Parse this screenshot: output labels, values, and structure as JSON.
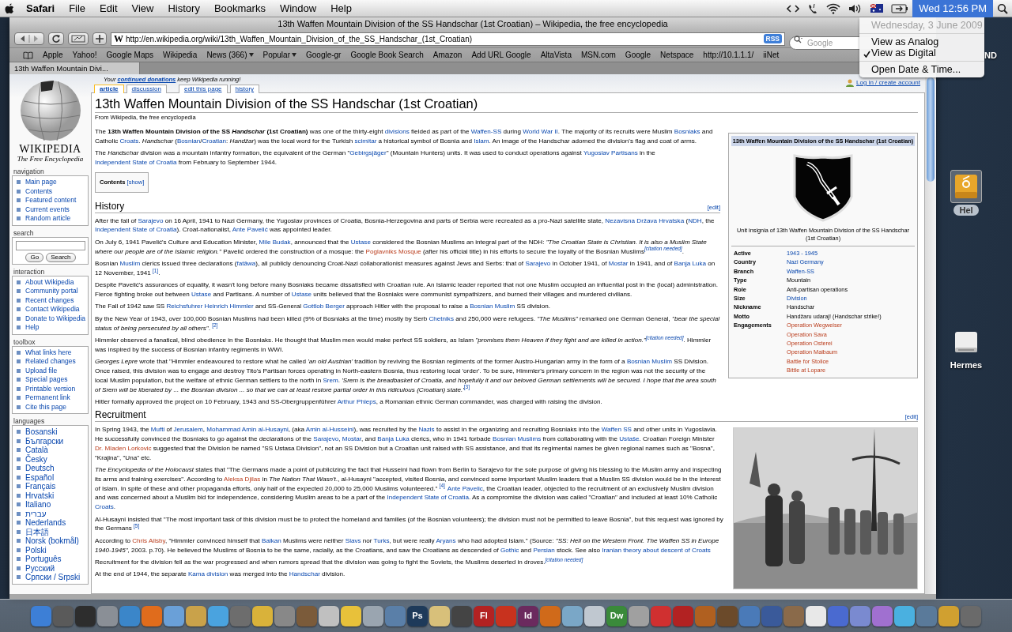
{
  "menubar": {
    "app_menu": "Safari",
    "menus": [
      "File",
      "Edit",
      "View",
      "History",
      "Bookmarks",
      "Window",
      "Help"
    ],
    "clock": {
      "label": "Wed 12:56 PM",
      "open": true
    }
  },
  "clock_menu": [
    {
      "label": "Wednesday, 3 June 2009",
      "kind": "date",
      "disabled": true,
      "checked": false
    },
    {
      "label": "View as Analog",
      "kind": "option",
      "disabled": false,
      "checked": false
    },
    {
      "label": "View as Digital",
      "kind": "option",
      "disabled": false,
      "checked": true
    },
    {
      "label": "Open Date & Time...",
      "kind": "action",
      "disabled": false,
      "checked": false
    }
  ],
  "window": {
    "title": "13th Waffen Mountain Division of the SS Handschar (1st Croatian) – Wikipedia, the free encyclopedia",
    "url": "http://en.wikipedia.org/wiki/13th_Waffen_Mountain_Division_of_the_SS_Handschar_(1st_Croatian)",
    "favicon": "W",
    "feed_badge": "RSS",
    "search_placeholder": "Google",
    "bookmarks": [
      {
        "label": "Apple",
        "kind": "link"
      },
      {
        "label": "Yahoo!",
        "kind": "link"
      },
      {
        "label": "Google Maps",
        "kind": "link"
      },
      {
        "label": "Wikipedia",
        "kind": "link"
      },
      {
        "label": "News (366)",
        "kind": "folder"
      },
      {
        "label": "Popular",
        "kind": "folder"
      },
      {
        "label": "Google-gr",
        "kind": "link"
      },
      {
        "label": "Google Book Search",
        "kind": "link"
      },
      {
        "label": "Amazon",
        "kind": "link"
      },
      {
        "label": "Add URL Google",
        "kind": "link"
      },
      {
        "label": "AltaVista",
        "kind": "link"
      },
      {
        "label": "MSN.com",
        "kind": "link"
      },
      {
        "label": "Google",
        "kind": "link"
      },
      {
        "label": "Netspace",
        "kind": "link"
      },
      {
        "label": "http://10.1.1.1/",
        "kind": "link"
      },
      {
        "label": "iiNet",
        "kind": "link"
      }
    ],
    "tabs": [
      {
        "label": "13th Waffen Mountain Divi...",
        "selected": true
      }
    ]
  },
  "page": {
    "notice": [
      {
        "kind": "text",
        "text": "Your "
      },
      {
        "kind": "link",
        "text": "continued donations"
      },
      {
        "kind": "text",
        "text": " keep Wikipedia running!"
      }
    ],
    "tabs": [
      {
        "label": "article",
        "selected": true
      },
      {
        "label": "discussion",
        "selected": false
      },
      {
        "label": "edit this page",
        "selected": false
      },
      {
        "label": "history",
        "selected": false
      }
    ],
    "login": "Log in / create account",
    "sidebar": {
      "logo_title": "WIKIPEDIA",
      "logo_tagline": "The Free Encyclopedia",
      "portlets": [
        {
          "title": "navigation",
          "kind": "links",
          "items": [
            "Main page",
            "Contents",
            "Featured content",
            "Current events",
            "Random article"
          ]
        },
        {
          "title": "search",
          "kind": "search",
          "buttons": [
            "Go",
            "Search"
          ]
        },
        {
          "title": "interaction",
          "kind": "links",
          "items": [
            "About Wikipedia",
            "Community portal",
            "Recent changes",
            "Contact Wikipedia",
            "Donate to Wikipedia",
            "Help"
          ]
        },
        {
          "title": "toolbox",
          "kind": "links",
          "items": [
            "What links here",
            "Related changes",
            "Upload file",
            "Special pages",
            "Printable version",
            "Permanent link",
            "Cite this page"
          ]
        },
        {
          "title": "languages",
          "kind": "languages",
          "items": [
            "Bosanski",
            "Български",
            "Català",
            "Česky",
            "Deutsch",
            "Español",
            "Français",
            "Hrvatski",
            "Italiano",
            "עברית",
            "Nederlands",
            "日本語",
            "Norsk (bokmål)",
            "Polski",
            "Português",
            "Русский",
            "Српски / Srpski"
          ]
        }
      ]
    },
    "article": {
      "title": "13th Waffen Mountain Division of the SS Handschar (1st Croatian)",
      "subtitle": "From Wikipedia, the free encyclopedia",
      "infobox": {
        "title": "13th Waffen Mountain Division of the SS Handschar (1st Croatian)",
        "caption": "Unit insignia of 13th Waffen Mountain Division of the SS Handschar (1st Croatian)",
        "rows": [
          {
            "label": "Active",
            "values": [
              {
                "kind": "link",
                "text": "1943 - 1945"
              }
            ]
          },
          {
            "label": "Country",
            "values": [
              {
                "kind": "link",
                "text": "Nazi Germany"
              }
            ]
          },
          {
            "label": "Branch",
            "values": [
              {
                "kind": "link",
                "text": "Waffen-SS"
              }
            ]
          },
          {
            "label": "Type",
            "values": [
              {
                "kind": "text",
                "text": "Mountain"
              }
            ]
          },
          {
            "label": "Role",
            "values": [
              {
                "kind": "text",
                "text": "Anti-partisan operations"
              }
            ]
          },
          {
            "label": "Size",
            "values": [
              {
                "kind": "link",
                "text": "Division"
              }
            ]
          },
          {
            "label": "Nickname",
            "values": [
              {
                "kind": "text",
                "text": "Handschar"
              }
            ]
          },
          {
            "label": "Motto",
            "values": [
              {
                "kind": "text",
                "text": "Handžaru udaraj! (Handschar strike!)"
              }
            ]
          },
          {
            "label": "Engagements",
            "values": [
              {
                "kind": "redlink",
                "text": "Operation Wegweiser"
              },
              {
                "kind": "redlink",
                "text": "Operation Sava"
              },
              {
                "kind": "redlink",
                "text": "Operation Osterei"
              },
              {
                "kind": "redlink",
                "text": "Operation Maibaum"
              },
              {
                "kind": "redlink",
                "text": "Battle for Stolice"
              },
              {
                "kind": "redlink",
                "text": "Bittle at Lopare"
              }
            ]
          }
        ]
      },
      "intro": [
        [
          {
            "kind": "text",
            "text": "The "
          },
          {
            "kind": "bold",
            "text": "13th Waffen Mountain Division of the SS "
          },
          {
            "kind": "bolditalic",
            "text": "Handschar"
          },
          {
            "kind": "bold",
            "text": " (1st Croatian)"
          },
          {
            "kind": "text",
            "text": " was one of the thirty-eight "
          },
          {
            "kind": "link",
            "text": "divisions"
          },
          {
            "kind": "text",
            "text": " fielded as part of the "
          },
          {
            "kind": "link",
            "text": "Waffen-SS"
          },
          {
            "kind": "text",
            "text": " during "
          },
          {
            "kind": "link",
            "text": "World War II"
          },
          {
            "kind": "text",
            "text": ". The majority of its recruits were Muslim "
          },
          {
            "kind": "link",
            "text": "Bosniaks"
          },
          {
            "kind": "text",
            "text": " and Catholic "
          },
          {
            "kind": "link",
            "text": "Croats"
          },
          {
            "kind": "text",
            "text": ". *Handschar* ("
          },
          {
            "kind": "link",
            "text": "Bosnian"
          },
          {
            "kind": "text",
            "text": "/"
          },
          {
            "kind": "link",
            "text": "Croatian"
          },
          {
            "kind": "text",
            "text": ": *Handžar*) was the local word for the Turkish "
          },
          {
            "kind": "link",
            "text": "scimitar"
          },
          {
            "kind": "text",
            "text": " a historical symbol of Bosnia and "
          },
          {
            "kind": "link",
            "text": "Islam"
          },
          {
            "kind": "text",
            "text": ". An image of the Handschar adorned the division's flag and coat of arms."
          }
        ],
        [
          {
            "kind": "text",
            "text": "The *Handschar* division was a mountain infantry formation, the equivalent of the German \""
          },
          {
            "kind": "link",
            "text": "Gebirgsjäger"
          },
          {
            "kind": "text",
            "text": "\" (Mountain Hunters) units. It was used to conduct operations against "
          },
          {
            "kind": "link",
            "text": "Yugoslav Partisans"
          },
          {
            "kind": "text",
            "text": " in the "
          },
          {
            "kind": "link",
            "text": "Independent State of Croatia"
          },
          {
            "kind": "text",
            "text": " from February to September 1944."
          }
        ]
      ],
      "contents": {
        "label": "Contents",
        "toggle": "[show]"
      },
      "sections": [
        {
          "heading": "History",
          "edit": "[edit]",
          "paragraphs": [
            [
              {
                "kind": "text",
                "text": "After the fall of "
              },
              {
                "kind": "link",
                "text": "Sarajevo"
              },
              {
                "kind": "text",
                "text": " on 16 April, 1941 to Nazi Germany, the Yugoslav provinces of Croatia, Bosnia-Herzegovina and parts of Serbia were recreated as a pro-Nazi satellite state, "
              },
              {
                "kind": "link",
                "text": "Nezavisna Država Hrvatska"
              },
              {
                "kind": "text",
                "text": " ("
              },
              {
                "kind": "link",
                "text": "NDH"
              },
              {
                "kind": "text",
                "text": ", the "
              },
              {
                "kind": "link",
                "text": "Independent State of Croatia"
              },
              {
                "kind": "text",
                "text": "). Croat-nationalist, "
              },
              {
                "kind": "link",
                "text": "Ante Pavelić"
              },
              {
                "kind": "text",
                "text": " was appointed leader."
              }
            ],
            [
              {
                "kind": "text",
                "text": "On July 6, 1941 Pavelić's Culture and Education Minister, "
              },
              {
                "kind": "link",
                "text": "Mile Budak"
              },
              {
                "kind": "text",
                "text": ", announced that the "
              },
              {
                "kind": "link",
                "text": "Ustase"
              },
              {
                "kind": "text",
                "text": " considered the Bosnian Muslims an integral part of the NDH: *\"The Croatian State is Christian. It is also a Muslim State where our people are of the Islamic religion.\"* Pavelić ordered the construction of a mosque: the "
              },
              {
                "kind": "redlink",
                "text": "Poglavniks Mosque"
              },
              {
                "kind": "text",
                "text": " (after his official title) in his efforts to secure the loyalty of the Bosnian Muslims"
              },
              {
                "kind": "cite",
                "text": "[citation needed]"
              },
              {
                "kind": "text",
                "text": "."
              }
            ],
            [
              {
                "kind": "text",
                "text": "Bosnian "
              },
              {
                "kind": "link",
                "text": "Muslim"
              },
              {
                "kind": "text",
                "text": " clerics issued three declarations ("
              },
              {
                "kind": "link",
                "text": "fatāwa"
              },
              {
                "kind": "text",
                "text": "), all publicly denouncing Croat-Nazi collaborationist measures against Jews and Serbs: that of "
              },
              {
                "kind": "link",
                "text": "Sarajevo"
              },
              {
                "kind": "text",
                "text": " in October 1941, of "
              },
              {
                "kind": "link",
                "text": "Mostar"
              },
              {
                "kind": "text",
                "text": " in 1941, and of "
              },
              {
                "kind": "link",
                "text": "Banja Luka"
              },
              {
                "kind": "text",
                "text": " on 12 November, 1941 "
              },
              {
                "kind": "ref",
                "text": "[1]"
              },
              {
                "kind": "text",
                "text": "."
              }
            ],
            [
              {
                "kind": "text",
                "text": "Despite Pavelić's assurances of equality, it wasn't long before many Bosniaks became dissatisfied with Croatian rule. An Islamic leader reported that not one Muslim occupied an influential post in the (local) administration. Fierce fighting broke out between "
              },
              {
                "kind": "link",
                "text": "Ustase"
              },
              {
                "kind": "text",
                "text": " and Partisans. A number of "
              },
              {
                "kind": "link",
                "text": "Ustase"
              },
              {
                "kind": "text",
                "text": " units believed that the Bosniaks were communist sympathizers, and burned their villages and murdered civilians."
              }
            ],
            [
              {
                "kind": "text",
                "text": "The Fall of 1942 saw SS "
              },
              {
                "kind": "link",
                "text": "Reichsfuhrer Heinrich Himmler"
              },
              {
                "kind": "text",
                "text": " and SS-General "
              },
              {
                "kind": "link",
                "text": "Gottlob Berger"
              },
              {
                "kind": "text",
                "text": " approach Hitler with the proposal to raise a "
              },
              {
                "kind": "link",
                "text": "Bosnian Muslim"
              },
              {
                "kind": "text",
                "text": " SS division."
              }
            ],
            [
              {
                "kind": "text",
                "text": "By the New Year of 1943, over 100,000 Bosnian Muslims had been killed (9% of Bosniaks at the time) mostly by Serb "
              },
              {
                "kind": "link",
                "text": "Chetniks"
              },
              {
                "kind": "text",
                "text": " and 250,000 were refugees. *\"The Muslims\"* remarked one German General, *\"bear the special status of being persecuted by all others\"*. "
              },
              {
                "kind": "ref",
                "text": "[2]"
              }
            ],
            [
              {
                "kind": "text",
                "text": "Himmler observed a fanatical, blind obedience in the Bosniaks. He thought that Muslim men would make perfect SS soldiers, as Islam *\"promises them Heaven if they fight and are killed in action.\"*"
              },
              {
                "kind": "cite",
                "text": "[citation needed]"
              },
              {
                "kind": "text",
                "text": ". Himmler was inspired by the success of Bosnian infantry regiments in WWI."
              }
            ],
            [
              {
                "kind": "text",
                "text": "*Georges Lepre* wrote that \"Himmler endeavoured to restore what he called *'an old Austrian'* tradition by reviving the Bosnian regiments of the former Austro-Hungarian army in the form of a "
              },
              {
                "kind": "link",
                "text": "Bosnian Muslim"
              },
              {
                "kind": "text",
                "text": " SS Division. Once raised, this division was to engage and destroy Tito's Partisan forces operating in North-eastern Bosnia, thus restoring local 'order'. To be sure, Himmler's primary concern in the region was not the security of the local Muslim population, but the welfare of ethnic German settlers to the north in "
              },
              {
                "kind": "link",
                "text": "Srem"
              },
              {
                "kind": "text",
                "text": ". *'Srem is the breadbasket of Croatia, and hopefully it and our beloved German settlements will be secured. I hope that the area south of Srem will be liberated by ... the Bosnian division ... so that we can at least restore partial order in this ridiculous (Croatian) state.'*"
              },
              {
                "kind": "ref",
                "text": "[3]"
              }
            ],
            [
              {
                "kind": "text",
                "text": "Hitler formally approved the project on 10 February, 1943 and SS-Obergruppenführer "
              },
              {
                "kind": "link",
                "text": "Arthur Phleps"
              },
              {
                "kind": "text",
                "text": ", a Romanian ethnic German commander, was charged with raising the division."
              }
            ]
          ]
        },
        {
          "heading": "Recruitment",
          "edit": "[edit]",
          "figure": {
            "kind": "picture"
          },
          "paragraphs": [
            [
              {
                "kind": "text",
                "text": "In Spring 1943, the "
              },
              {
                "kind": "link",
                "text": "Mufti"
              },
              {
                "kind": "text",
                "text": " of "
              },
              {
                "kind": "link",
                "text": "Jerusalem"
              },
              {
                "kind": "text",
                "text": ", "
              },
              {
                "kind": "link",
                "text": "Mohammad Amin al-Husayni"
              },
              {
                "kind": "text",
                "text": ", (aka "
              },
              {
                "kind": "link",
                "text": "Amin al-Husseini"
              },
              {
                "kind": "text",
                "text": "), was recruited by the "
              },
              {
                "kind": "link",
                "text": "Nazis"
              },
              {
                "kind": "text",
                "text": " to assist in the organizing and recruiting Bosniaks into the "
              },
              {
                "kind": "link",
                "text": "Waffen SS"
              },
              {
                "kind": "text",
                "text": " and other units in Yugoslavia. He successfully convinced the Bosniaks to go against the declarations of the "
              },
              {
                "kind": "link",
                "text": "Sarajevo"
              },
              {
                "kind": "text",
                "text": ", "
              },
              {
                "kind": "link",
                "text": "Mostar"
              },
              {
                "kind": "text",
                "text": ", and "
              },
              {
                "kind": "link",
                "text": "Banja Luka"
              },
              {
                "kind": "text",
                "text": " clerics, who in 1941 forbade "
              },
              {
                "kind": "link",
                "text": "Bosnian Muslims"
              },
              {
                "kind": "text",
                "text": " from collaborating with the "
              },
              {
                "kind": "link",
                "text": "Ustaše"
              },
              {
                "kind": "text",
                "text": ". Croatian Foreign Minister "
              },
              {
                "kind": "redlink",
                "text": "Dr. Mladen Lorkovic"
              },
              {
                "kind": "text",
                "text": " suggested that the Division be named \"SS Ustasa Division\", not an SS Division but a Croatian unit raised with SS assistance, and that its regimental names be given regional names such as \"Bosna\", \"Krajina\", \"Una\" etc."
              }
            ],
            [
              {
                "kind": "text",
                "text": "*The Encyclopedia of the Holocaust* states that \"The Germans made a point of publicizing the fact that Husseini had flown from Berlin to Sarajevo for the sole purpose of giving his blessing to the Muslim army and inspecting its arms and training exercises\". According to "
              },
              {
                "kind": "redlink",
                "text": "Aleksa Djilas"
              },
              {
                "kind": "text",
                "text": " in *The Nation That Wasn't*., al-Husayni \"accepted, visited Bosnia, and convinced some important Muslim leaders that a Muslim SS division would be in the interest of Islam. In spite of these and other propaganda efforts, only half of the expected 20,000 to 25,000 Muslims volunteered.\" "
              },
              {
                "kind": "ref",
                "text": "[4]"
              },
              {
                "kind": "link",
                "text": "Ante Pavelic"
              },
              {
                "kind": "text",
                "text": ", the Croatian leader, objected to the recruitment of an exclusively Muslim division and was concerned about a Muslim bid for independence, considering Muslim areas to be a part of the "
              },
              {
                "kind": "link",
                "text": "Independent State of Croatia"
              },
              {
                "kind": "text",
                "text": ". As a compromise the division was called \"Croatian\" and included at least 10% Catholic "
              },
              {
                "kind": "link",
                "text": "Croats"
              },
              {
                "kind": "text",
                "text": "."
              }
            ],
            [
              {
                "kind": "text",
                "text": "Al-Husayni insisted that \"The most important task of this division must be to protect the homeland and families (of the Bosnian volunteers); the division must not be permitted to leave Bosnia\", but this request was ignored by the Germans "
              },
              {
                "kind": "ref",
                "text": "[5]"
              }
            ],
            [
              {
                "kind": "text",
                "text": "According to "
              },
              {
                "kind": "redlink",
                "text": "Chris Ailsby"
              },
              {
                "kind": "text",
                "text": ", \"Himmler convinced himself that "
              },
              {
                "kind": "link",
                "text": "Balkan"
              },
              {
                "kind": "text",
                "text": " Muslims were neither "
              },
              {
                "kind": "link",
                "text": "Slavs"
              },
              {
                "kind": "text",
                "text": " nor "
              },
              {
                "kind": "link",
                "text": "Turks"
              },
              {
                "kind": "text",
                "text": ", but were really "
              },
              {
                "kind": "link",
                "text": "Aryans"
              },
              {
                "kind": "text",
                "text": " who had adopted Islam.\" (Source: *\"SS: Hell on the Western Front. The Waffen SS in Europe 1940-1945\"*, 2003. p.70). He believed the Muslims of Bosnia to be the same, racially, as the Croatians, and saw the Croatians as descended of "
              },
              {
                "kind": "link",
                "text": "Gothic"
              },
              {
                "kind": "text",
                "text": " and "
              },
              {
                "kind": "link",
                "text": "Persian"
              },
              {
                "kind": "text",
                "text": " stock. See also "
              },
              {
                "kind": "link",
                "text": "Iranian theory about descent of Croats"
              }
            ],
            [
              {
                "kind": "text",
                "text": "Recruitment for the division fell as the war progressed and when rumors spread that the division was going to fight the Soviets, the Muslims deserted in droves."
              },
              {
                "kind": "cite",
                "text": "[citation needed]"
              }
            ],
            [
              {
                "kind": "text",
                "text": "At the end of 1944, the separate "
              },
              {
                "kind": "link",
                "text": "Kama division"
              },
              {
                "kind": "text",
                "text": " was merged into the "
              },
              {
                "kind": "link",
                "text": "Handschar"
              },
              {
                "kind": "text",
                "text": " division."
              }
            ]
          ]
        }
      ]
    }
  },
  "desktop": {
    "partial_label": "ND",
    "icons": [
      {
        "label": "Hel",
        "kind": "firewire-drive",
        "selected": true
      },
      {
        "label": "Hermes",
        "kind": "drive",
        "selected": false
      }
    ]
  },
  "dock": [
    {
      "color": "#3d7fd6"
    },
    {
      "color": "#5a5a5a"
    },
    {
      "color": "#2d2d2d"
    },
    {
      "color": "#8a8f96"
    },
    {
      "color": "#3b86c9"
    },
    {
      "color": "#e06c1c"
    },
    {
      "color": "#6aa0d8"
    },
    {
      "color": "#c9a24a"
    },
    {
      "color": "#4aa3df"
    },
    {
      "color": "#6d6d6d"
    },
    {
      "color": "#d9b23a"
    },
    {
      "color": "#888888"
    },
    {
      "color": "#7b5b3a"
    },
    {
      "color": "#c0c0c0"
    },
    {
      "color": "#e8c13a"
    },
    {
      "color": "#9aa5b0"
    },
    {
      "color": "#5a7fa8"
    },
    {
      "color": "#1e3a5a",
      "label": "Ps"
    },
    {
      "color": "#d8c07a"
    },
    {
      "color": "#444444"
    },
    {
      "color": "#b32222",
      "label": "Fl"
    },
    {
      "color": "#c8321e"
    },
    {
      "color": "#6b2a5e",
      "label": "Id"
    },
    {
      "color": "#d06a1a"
    },
    {
      "color": "#7aa7c7"
    },
    {
      "color": "#c0c8d0"
    },
    {
      "color": "#3a8a3a",
      "label": "Dw"
    },
    {
      "color": "#a0a0a0"
    },
    {
      "color": "#d03030"
    },
    {
      "color": "#b22222"
    },
    {
      "color": "#b06020"
    },
    {
      "color": "#6b4a2a"
    },
    {
      "color": "#4a7ab8"
    },
    {
      "color": "#3a5a9a"
    },
    {
      "color": "#8a6a4a"
    },
    {
      "color": "#e8e8e8"
    },
    {
      "color": "#4a6ad0"
    },
    {
      "color": "#7a8ad0"
    },
    {
      "color": "#a070d0"
    },
    {
      "color": "#4ab0e0"
    },
    {
      "color": "#5a7a9a"
    },
    {
      "color": "#d0a030"
    },
    {
      "color": "#6a6a6a"
    }
  ]
}
